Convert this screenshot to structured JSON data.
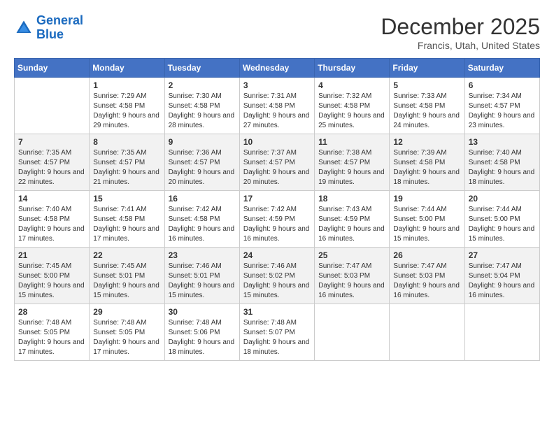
{
  "header": {
    "logo_line1": "General",
    "logo_line2": "Blue",
    "month_title": "December 2025",
    "location": "Francis, Utah, United States"
  },
  "days_of_week": [
    "Sunday",
    "Monday",
    "Tuesday",
    "Wednesday",
    "Thursday",
    "Friday",
    "Saturday"
  ],
  "weeks": [
    [
      {
        "day": "",
        "sunrise": "",
        "sunset": "",
        "daylight": ""
      },
      {
        "day": "1",
        "sunrise": "Sunrise: 7:29 AM",
        "sunset": "Sunset: 4:58 PM",
        "daylight": "Daylight: 9 hours and 29 minutes."
      },
      {
        "day": "2",
        "sunrise": "Sunrise: 7:30 AM",
        "sunset": "Sunset: 4:58 PM",
        "daylight": "Daylight: 9 hours and 28 minutes."
      },
      {
        "day": "3",
        "sunrise": "Sunrise: 7:31 AM",
        "sunset": "Sunset: 4:58 PM",
        "daylight": "Daylight: 9 hours and 27 minutes."
      },
      {
        "day": "4",
        "sunrise": "Sunrise: 7:32 AM",
        "sunset": "Sunset: 4:58 PM",
        "daylight": "Daylight: 9 hours and 25 minutes."
      },
      {
        "day": "5",
        "sunrise": "Sunrise: 7:33 AM",
        "sunset": "Sunset: 4:58 PM",
        "daylight": "Daylight: 9 hours and 24 minutes."
      },
      {
        "day": "6",
        "sunrise": "Sunrise: 7:34 AM",
        "sunset": "Sunset: 4:57 PM",
        "daylight": "Daylight: 9 hours and 23 minutes."
      }
    ],
    [
      {
        "day": "7",
        "sunrise": "Sunrise: 7:35 AM",
        "sunset": "Sunset: 4:57 PM",
        "daylight": "Daylight: 9 hours and 22 minutes."
      },
      {
        "day": "8",
        "sunrise": "Sunrise: 7:35 AM",
        "sunset": "Sunset: 4:57 PM",
        "daylight": "Daylight: 9 hours and 21 minutes."
      },
      {
        "day": "9",
        "sunrise": "Sunrise: 7:36 AM",
        "sunset": "Sunset: 4:57 PM",
        "daylight": "Daylight: 9 hours and 20 minutes."
      },
      {
        "day": "10",
        "sunrise": "Sunrise: 7:37 AM",
        "sunset": "Sunset: 4:57 PM",
        "daylight": "Daylight: 9 hours and 20 minutes."
      },
      {
        "day": "11",
        "sunrise": "Sunrise: 7:38 AM",
        "sunset": "Sunset: 4:57 PM",
        "daylight": "Daylight: 9 hours and 19 minutes."
      },
      {
        "day": "12",
        "sunrise": "Sunrise: 7:39 AM",
        "sunset": "Sunset: 4:58 PM",
        "daylight": "Daylight: 9 hours and 18 minutes."
      },
      {
        "day": "13",
        "sunrise": "Sunrise: 7:40 AM",
        "sunset": "Sunset: 4:58 PM",
        "daylight": "Daylight: 9 hours and 18 minutes."
      }
    ],
    [
      {
        "day": "14",
        "sunrise": "Sunrise: 7:40 AM",
        "sunset": "Sunset: 4:58 PM",
        "daylight": "Daylight: 9 hours and 17 minutes."
      },
      {
        "day": "15",
        "sunrise": "Sunrise: 7:41 AM",
        "sunset": "Sunset: 4:58 PM",
        "daylight": "Daylight: 9 hours and 17 minutes."
      },
      {
        "day": "16",
        "sunrise": "Sunrise: 7:42 AM",
        "sunset": "Sunset: 4:58 PM",
        "daylight": "Daylight: 9 hours and 16 minutes."
      },
      {
        "day": "17",
        "sunrise": "Sunrise: 7:42 AM",
        "sunset": "Sunset: 4:59 PM",
        "daylight": "Daylight: 9 hours and 16 minutes."
      },
      {
        "day": "18",
        "sunrise": "Sunrise: 7:43 AM",
        "sunset": "Sunset: 4:59 PM",
        "daylight": "Daylight: 9 hours and 16 minutes."
      },
      {
        "day": "19",
        "sunrise": "Sunrise: 7:44 AM",
        "sunset": "Sunset: 5:00 PM",
        "daylight": "Daylight: 9 hours and 15 minutes."
      },
      {
        "day": "20",
        "sunrise": "Sunrise: 7:44 AM",
        "sunset": "Sunset: 5:00 PM",
        "daylight": "Daylight: 9 hours and 15 minutes."
      }
    ],
    [
      {
        "day": "21",
        "sunrise": "Sunrise: 7:45 AM",
        "sunset": "Sunset: 5:00 PM",
        "daylight": "Daylight: 9 hours and 15 minutes."
      },
      {
        "day": "22",
        "sunrise": "Sunrise: 7:45 AM",
        "sunset": "Sunset: 5:01 PM",
        "daylight": "Daylight: 9 hours and 15 minutes."
      },
      {
        "day": "23",
        "sunrise": "Sunrise: 7:46 AM",
        "sunset": "Sunset: 5:01 PM",
        "daylight": "Daylight: 9 hours and 15 minutes."
      },
      {
        "day": "24",
        "sunrise": "Sunrise: 7:46 AM",
        "sunset": "Sunset: 5:02 PM",
        "daylight": "Daylight: 9 hours and 15 minutes."
      },
      {
        "day": "25",
        "sunrise": "Sunrise: 7:47 AM",
        "sunset": "Sunset: 5:03 PM",
        "daylight": "Daylight: 9 hours and 16 minutes."
      },
      {
        "day": "26",
        "sunrise": "Sunrise: 7:47 AM",
        "sunset": "Sunset: 5:03 PM",
        "daylight": "Daylight: 9 hours and 16 minutes."
      },
      {
        "day": "27",
        "sunrise": "Sunrise: 7:47 AM",
        "sunset": "Sunset: 5:04 PM",
        "daylight": "Daylight: 9 hours and 16 minutes."
      }
    ],
    [
      {
        "day": "28",
        "sunrise": "Sunrise: 7:48 AM",
        "sunset": "Sunset: 5:05 PM",
        "daylight": "Daylight: 9 hours and 17 minutes."
      },
      {
        "day": "29",
        "sunrise": "Sunrise: 7:48 AM",
        "sunset": "Sunset: 5:05 PM",
        "daylight": "Daylight: 9 hours and 17 minutes."
      },
      {
        "day": "30",
        "sunrise": "Sunrise: 7:48 AM",
        "sunset": "Sunset: 5:06 PM",
        "daylight": "Daylight: 9 hours and 18 minutes."
      },
      {
        "day": "31",
        "sunrise": "Sunrise: 7:48 AM",
        "sunset": "Sunset: 5:07 PM",
        "daylight": "Daylight: 9 hours and 18 minutes."
      },
      {
        "day": "",
        "sunrise": "",
        "sunset": "",
        "daylight": ""
      },
      {
        "day": "",
        "sunrise": "",
        "sunset": "",
        "daylight": ""
      },
      {
        "day": "",
        "sunrise": "",
        "sunset": "",
        "daylight": ""
      }
    ]
  ]
}
